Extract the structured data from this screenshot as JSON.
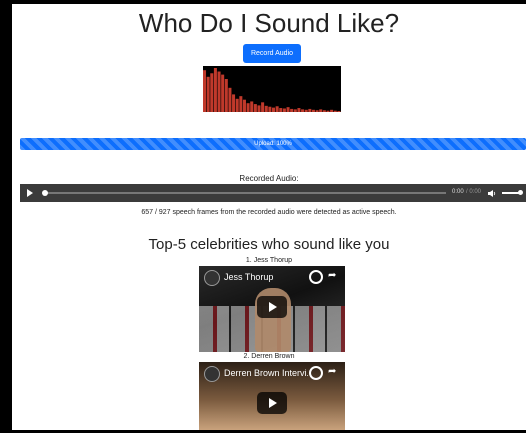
{
  "page": {
    "title": "Who Do I Sound Like?",
    "record_button": "Record Audio"
  },
  "upload": {
    "label": "Upload: 100%",
    "progress": 100
  },
  "audio": {
    "label": "Recorded Audio:",
    "time_current": "0:00",
    "time_separator": " / ",
    "time_total": "0:00"
  },
  "speech_status": "657 / 927 speech frames from the recorded audio were detected as active speech.",
  "results": {
    "heading": "Top-5 celebrities who sound like you",
    "items": [
      {
        "rank_label": "1. Jess Thorup",
        "video_title": "Jess Thorup"
      },
      {
        "rank_label": "2. Derren Brown",
        "video_title": "Derren Brown Intervi..."
      }
    ]
  },
  "colors": {
    "accent": "#0d6efd",
    "visualizer_bar": "#c0392b",
    "visualizer_bg": "#000000",
    "player_bg": "#3b3b3b"
  },
  "visualizer_levels": [
    0.95,
    0.8,
    0.88,
    1.0,
    0.92,
    0.85,
    0.75,
    0.55,
    0.4,
    0.3,
    0.36,
    0.28,
    0.2,
    0.24,
    0.18,
    0.15,
    0.22,
    0.14,
    0.12,
    0.1,
    0.13,
    0.09,
    0.08,
    0.11,
    0.07,
    0.06,
    0.09,
    0.06,
    0.05,
    0.07,
    0.05,
    0.04,
    0.06,
    0.04,
    0.03,
    0.05,
    0.03,
    0.02
  ]
}
